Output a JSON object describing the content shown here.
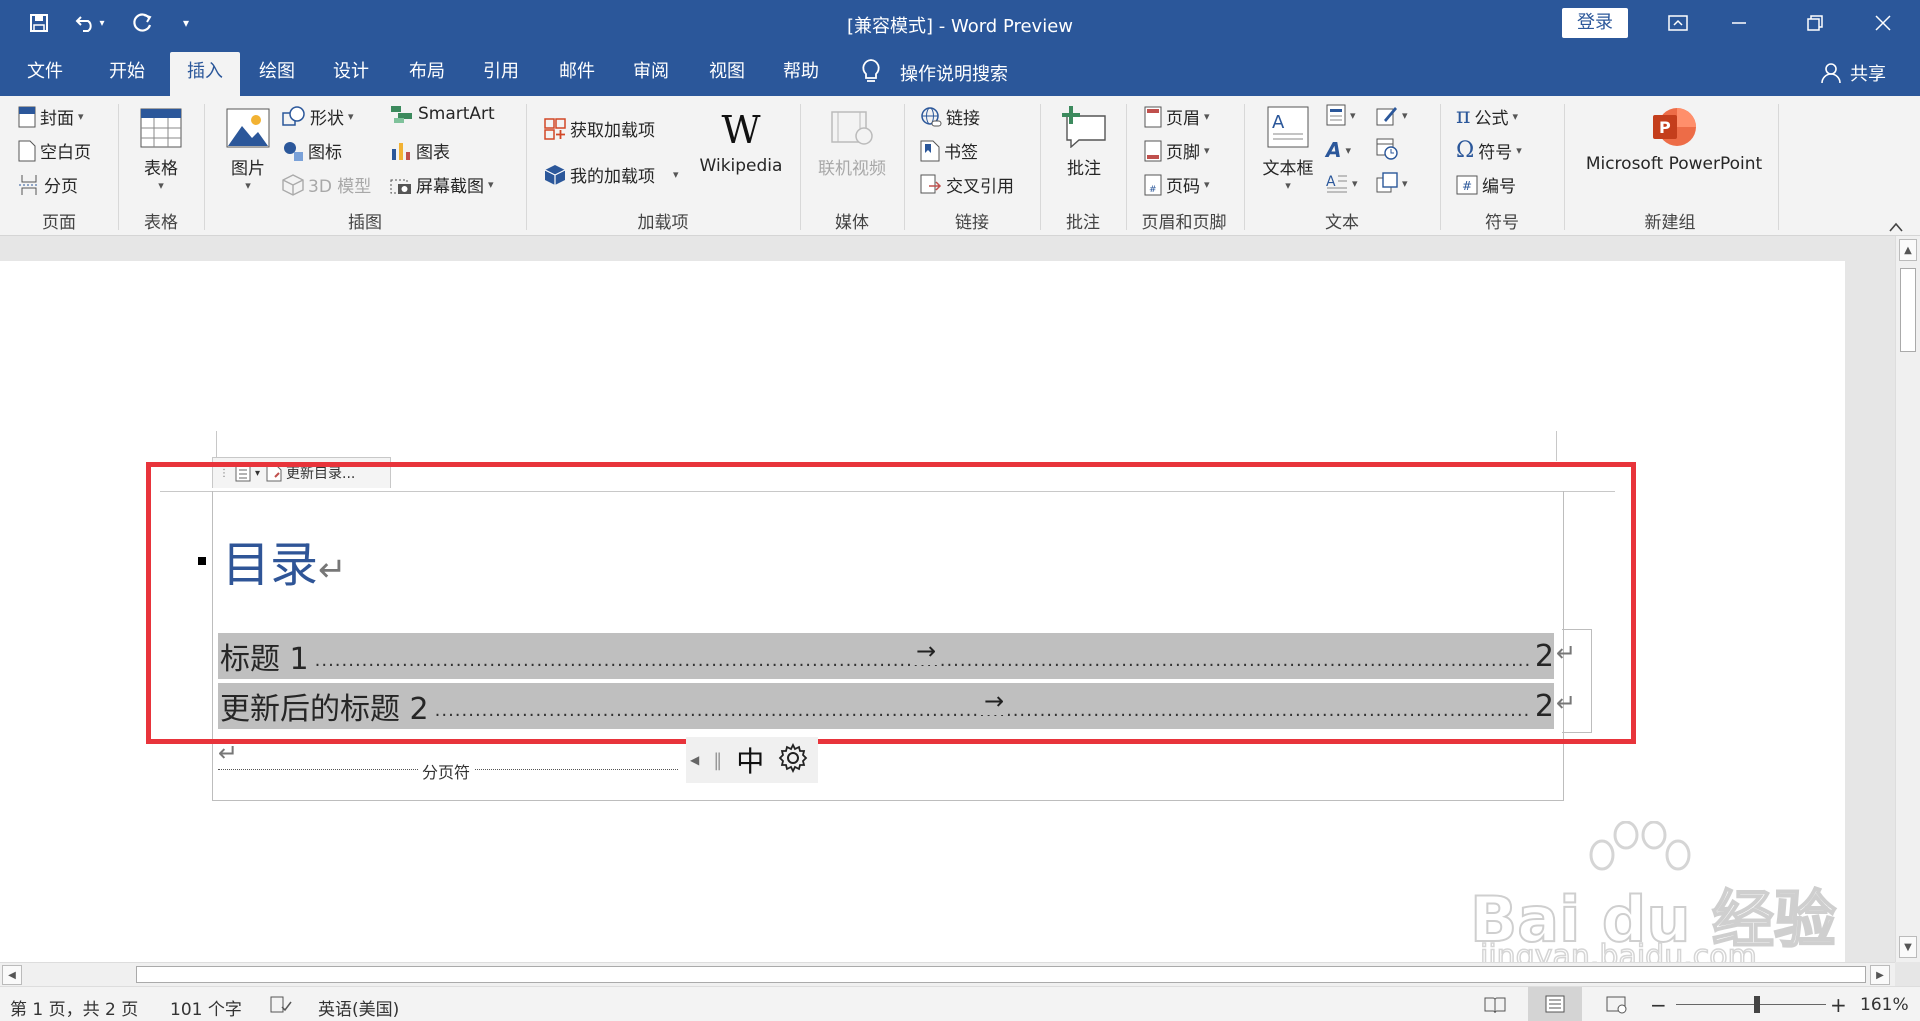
{
  "titlebar": {
    "title": "[兼容模式]  -  Word Preview",
    "login_label": "登录"
  },
  "tabs": [
    {
      "label": "文件",
      "active": false
    },
    {
      "label": "开始",
      "active": false
    },
    {
      "label": "插入",
      "active": true
    },
    {
      "label": "绘图",
      "active": false
    },
    {
      "label": "设计",
      "active": false
    },
    {
      "label": "布局",
      "active": false
    },
    {
      "label": "引用",
      "active": false
    },
    {
      "label": "邮件",
      "active": false
    },
    {
      "label": "审阅",
      "active": false
    },
    {
      "label": "视图",
      "active": false
    },
    {
      "label": "帮助",
      "active": false
    }
  ],
  "search": {
    "label": "操作说明搜索"
  },
  "share": {
    "label": "共享"
  },
  "ribbon": {
    "pages": {
      "group": "页面",
      "cover": "封面",
      "blank": "空白页",
      "break": "分页"
    },
    "tables": {
      "group": "表格",
      "table": "表格"
    },
    "illustrations": {
      "group": "插图",
      "pictures": "图片",
      "shapes": "形状",
      "icons": "图标",
      "models3d": "3D 模型",
      "smartart": "SmartArt",
      "chart": "图表",
      "screenshot": "屏幕截图"
    },
    "addins": {
      "group": "加载项",
      "get": "获取加载项",
      "mine": "我的加载项",
      "wikipedia": "Wikipedia"
    },
    "media": {
      "group": "媒体",
      "video": "联机视频"
    },
    "links": {
      "group": "链接",
      "link": "链接",
      "bookmark": "书签",
      "crossref": "交叉引用"
    },
    "comments": {
      "group": "批注",
      "comment": "批注"
    },
    "header_footer": {
      "group": "页眉和页脚",
      "header": "页眉",
      "footer": "页脚",
      "page_number": "页码"
    },
    "text": {
      "group": "文本",
      "textbox": "文本框"
    },
    "symbols": {
      "group": "符号",
      "equation": "公式",
      "symbol": "符号",
      "number": "编号"
    },
    "newgroup": {
      "group": "新建组",
      "ppt": "Microsoft PowerPoint"
    }
  },
  "toc": {
    "update_label": "更新目录...",
    "title": "目录",
    "entries": [
      {
        "text": "标题 1",
        "page": "2"
      },
      {
        "text": "更新后的标题 2",
        "page": "2"
      }
    ]
  },
  "page_break": {
    "label": "分页符"
  },
  "ime": {
    "mode": "中"
  },
  "status": {
    "page": "第 1 页，共 2 页",
    "words": "101 个字",
    "language": "英语(美国)",
    "zoom": "161%"
  },
  "watermark": {
    "logo": "Bai du 经验",
    "url": "jingyan.baidu.com"
  },
  "colors": {
    "brand": "#2b579a",
    "highlight_box": "#e8343b",
    "toc_field": "#bfbfbf",
    "toc_title": "#2f5597"
  }
}
